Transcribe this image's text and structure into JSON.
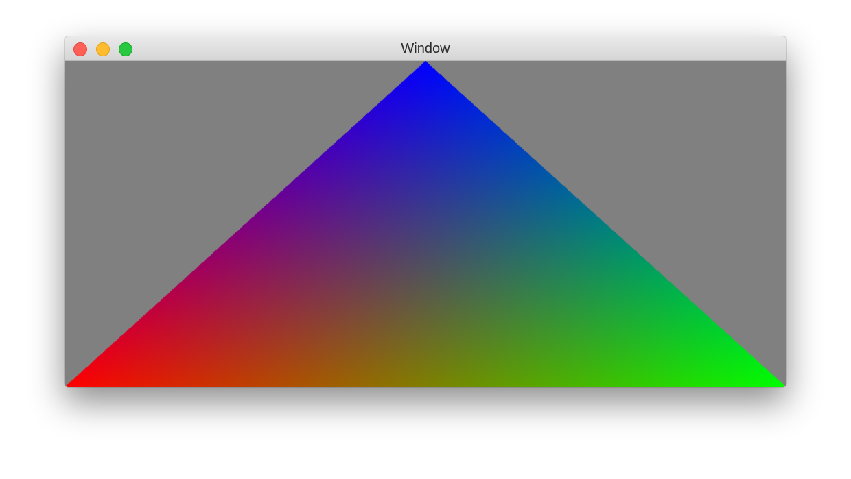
{
  "window": {
    "title": "Window",
    "controls": {
      "close_color": "#fe5f57",
      "minimize_color": "#febc2e",
      "zoom_color": "#28c840"
    }
  },
  "scene": {
    "clear_color": "#808080",
    "triangle": {
      "vertices": [
        {
          "name": "bottom-left",
          "color": "#ff0000"
        },
        {
          "name": "bottom-right",
          "color": "#00ff00"
        },
        {
          "name": "top",
          "color": "#0000ff"
        }
      ]
    }
  }
}
